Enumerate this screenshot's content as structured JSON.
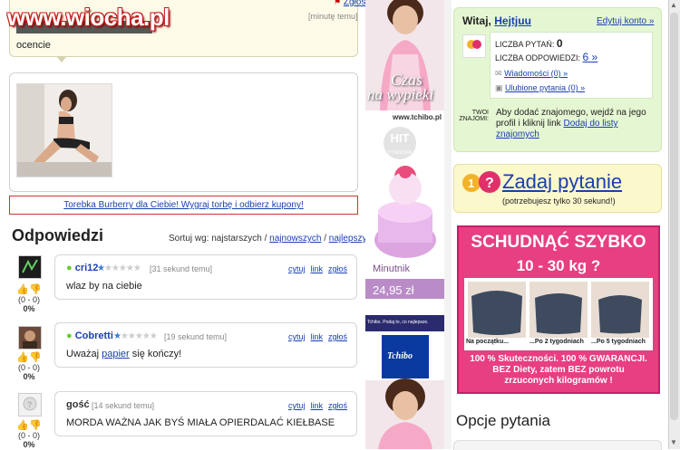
{
  "watermark": "www.wiocha.pl",
  "question": {
    "report_link": "Zgłoś",
    "time": "[minutę temu]",
    "text_partial": "ocencie"
  },
  "ad_banner": "Torebka Burberry dla Ciebie! Wygraj torbę i odbierz kupony!",
  "answers_section": {
    "title": "Odpowiedzi",
    "sort_label": "Sortuj wg: najstarszych /",
    "sort_newest": "najnowszych",
    "sort_sep": "/",
    "sort_best": "najlepszych"
  },
  "answers": [
    {
      "name": "cri12",
      "time": "[31 sekund temu]",
      "text": "wlaz by na ciebie",
      "votes": "(0 - 0)",
      "pct": "0%"
    },
    {
      "name": "Cobretti",
      "time": "[19 sekund temu]",
      "text_before": "Uważaj ",
      "text_link": "papier",
      "text_after": " się kończy!",
      "votes": "(0 - 0)",
      "pct": "0%"
    },
    {
      "name": "gość",
      "time": "[14 sekund temu]",
      "text": "MORDA WAŻNA JAK BYŚ MIAŁA OPIERDALAĆ KIEŁBASE",
      "votes": "(0 - 0)",
      "pct": "0%"
    }
  ],
  "answer_actions": {
    "quote": "cytuj",
    "link": "link",
    "report": "zgłoś"
  },
  "mid_ad": {
    "tagline1": "Czas",
    "tagline2": "na wypieki",
    "site": "www.tchibo.pl",
    "badge": "HIT",
    "badge_sub": "TYGODNIA",
    "product": "Minutnik",
    "price": "24,95 zł",
    "footer": "Tchibo. Podaj to, co najlepsze.",
    "brand": "Tchibo"
  },
  "user_box": {
    "greeting": "Witaj,",
    "username": "Hejtjuu",
    "edit": "Edytuj konto »",
    "questions_label": "LICZBA PYTAŃ:",
    "questions_count": "0",
    "answers_label": "LICZBA ODPOWIEDZI:",
    "answers_count": "6 »",
    "messages": "Wiadomości (0) »",
    "favorites": "Ulubione pytania (0) »",
    "friends_label1": "TWOI",
    "friends_label2": "ZNAJOMI:",
    "friends_text": "Aby dodać znajomego, wejdź na jego profil i kliknij link",
    "friends_link": "Dodaj do listy znajomych"
  },
  "ask": {
    "button": "Zadaj pytanie",
    "hint": "(potrzebujesz tylko 30 sekund!)"
  },
  "diet_ad": {
    "title": "SCHUDNĄĆ SZYBKO",
    "subtitle": "10 - 30 kg ?",
    "cap1": "Na początku...",
    "cap2": "...Po 2 tygodniach",
    "cap3": "...Po 5 tygodniach",
    "line1": "100 % Skuteczności. 100 % GWARANCJI.",
    "line2": "BEZ Diety, zatem BEZ powrotu",
    "line3": "zrzuconych kilogramów !"
  },
  "options_title": "Opcje pytania",
  "colors": {
    "link": "#1a3fb0",
    "green_box": "#e5f6d2",
    "yellow_box": "#fbf8cc",
    "pink_ad": "#e83e82"
  }
}
